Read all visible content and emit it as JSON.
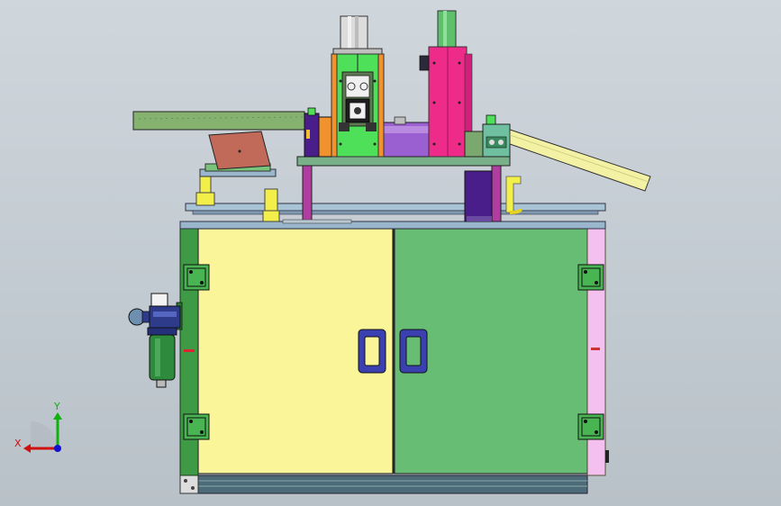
{
  "window": {
    "title": ""
  },
  "triad": {
    "x_label": "X",
    "y_label": "Y",
    "x_color": "#d01010",
    "y_color": "#10b010",
    "z_color": "#1010d0"
  },
  "colors": {
    "background": "#c8cfd6",
    "cabinet_left_door": "#fbf59a",
    "cabinet_right_door": "#67bd74",
    "cabinet_side_green": "#3e9a45",
    "cabinet_side_pink": "#f4c0f0",
    "press_frame_green": "#4fe05a",
    "press_frame_orange": "#f2922e",
    "press_magenta": "#ef2b8a",
    "purple_block": "#9a5fd0",
    "dark_purple": "#4a1e8a",
    "olive_beam": "#86b270",
    "chute_yellow": "#f3f1a4",
    "tray_brown": "#c26a5a",
    "plate_gray": "#9ab6cc"
  }
}
